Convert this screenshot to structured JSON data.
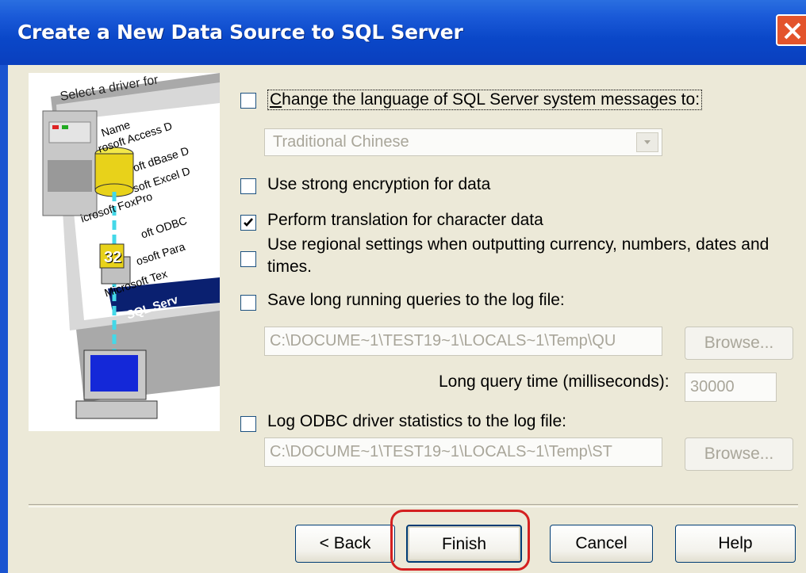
{
  "window": {
    "title": "Create a New Data Source to SQL Server"
  },
  "illustration": {
    "lines": [
      "Select a driver for",
      "Name",
      "rosoft Access D",
      "oft dBase D",
      "soft Excel D",
      "icrosoft FoxPro",
      "oft ODBC",
      "osoft Para",
      "Microsoft Tex",
      "SQL Serv"
    ],
    "badge": "32"
  },
  "options": {
    "change_language": {
      "label": "Change the language of SQL Server system messages to:",
      "checked": false
    },
    "language_select": {
      "value": "Traditional Chinese"
    },
    "strong_encryption": {
      "label": "Use strong encryption for data",
      "checked": false
    },
    "translation": {
      "label": "Perform translation for character data",
      "checked": true
    },
    "regional": {
      "label_line1": "Use regional settings when outputting currency, numbers, dates and",
      "label_line2": "times.",
      "checked": false
    },
    "long_queries": {
      "label": "Save long running queries to the log file:",
      "checked": false,
      "path": "C:\\DOCUME~1\\TEST19~1\\LOCALS~1\\Temp\\QU",
      "browse": "Browse..."
    },
    "long_query_time": {
      "label": "Long query time (milliseconds):",
      "value": "30000"
    },
    "odbc_stats": {
      "label": "Log ODBC driver statistics to the log file:",
      "checked": false,
      "path": "C:\\DOCUME~1\\TEST19~1\\LOCALS~1\\Temp\\ST",
      "browse": "Browse..."
    }
  },
  "buttons": {
    "back": "< Back",
    "finish": "Finish",
    "cancel": "Cancel",
    "help": "Help"
  },
  "colors": {
    "title_bar": "#0a47c8",
    "dialog_bg": "#ece9d8",
    "highlight": "#d42020"
  }
}
